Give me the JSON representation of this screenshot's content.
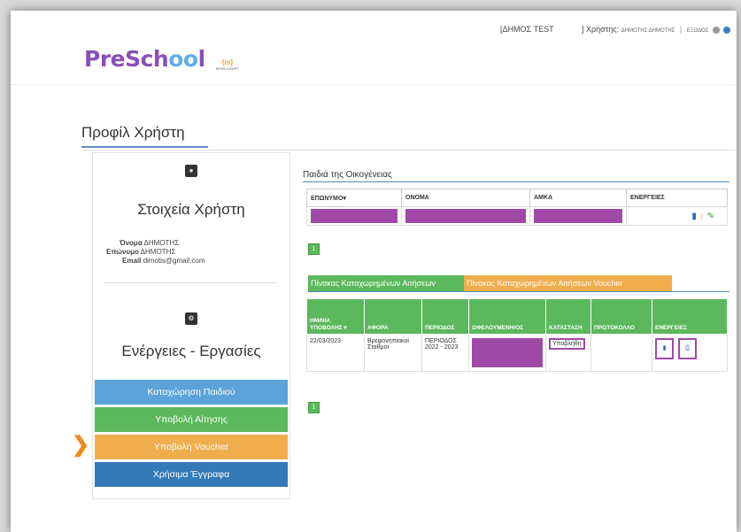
{
  "topbar": {
    "municipality": "[ΔΗΜΟΣ TEST",
    "user_label": "] Χρήστης:",
    "user_name": "ΔΗΜΟΤΗΣ ΔΗΜΟΤΗΣ",
    "logout": "ΕΞΟΔΟΣ",
    "sep": "|"
  },
  "logo": {
    "pre": "Pre",
    "sch": "Sch",
    "oo": "oo",
    "l": "l",
    "is_text": "{is}",
    "is_sub": "INTELLISOFT"
  },
  "page_title": "Προφίλ Χρήστη",
  "profile": {
    "section_title": "Στοιχεία Χρήστη",
    "first_name_label": "Όνομα",
    "first_name": "ΔΗΜΟΤΗΣ",
    "last_name_label": "Επώνυμο",
    "last_name": "ΔΗΜΟΤΗΣ",
    "email_label": "Email",
    "email": "dimotis@gmail.com"
  },
  "actions": {
    "section_title": "Ενέργειες - Εργασίες",
    "buttons": [
      {
        "label": "Καταχώρηση Παιδιού",
        "color": "#5ba3d9"
      },
      {
        "label": "Υποβολή Αίτησης",
        "color": "#5cb85c"
      },
      {
        "label": "Υποβολή Voucher",
        "color": "#f0ad4e"
      },
      {
        "label": "Χρήσιμα Έγγραφα",
        "color": "#337ab7"
      }
    ]
  },
  "children": {
    "title": "Παιδιά της Οικογένειας",
    "headers": [
      "ΕΠΩΝΥΜΟ▾",
      "ΟΝΟΜΑ",
      "ΑΜΚΑ",
      "ΕΝΕΡΓΕΙΕΣ"
    ],
    "page": "1",
    "action_sep": "|"
  },
  "tabs": [
    "Πίνακας Καταχωρημένων Αιτήσεων",
    "Πίνακας Καταχωρημένων Αιτήσεων Voucher"
  ],
  "applications": {
    "headers": [
      "ΗΜ/ΝΙΑ ΥΠΟΒΟΛΗΣ ▾",
      "ΑΦΟΡΑ",
      "ΠΕΡΙΟΔΟΣ",
      "ΩΦΕΛΟΥΜΕΝΗ/ΟΣ",
      "ΚΑΤΑΣΤΑΣΗ",
      "ΠΡΩΤΟΚΟΛΛΟ",
      "ΕΝΕΡΓΕΙΕΣ"
    ],
    "row": {
      "date": "22/03/2023",
      "about": "Βρεφονηπιακοί Σταθμοί",
      "period": "ΠΕΡΙΟΔΟΣ 2022 - 2023",
      "status": "Υποβλήθη",
      "protocol": ""
    },
    "page": "1"
  }
}
